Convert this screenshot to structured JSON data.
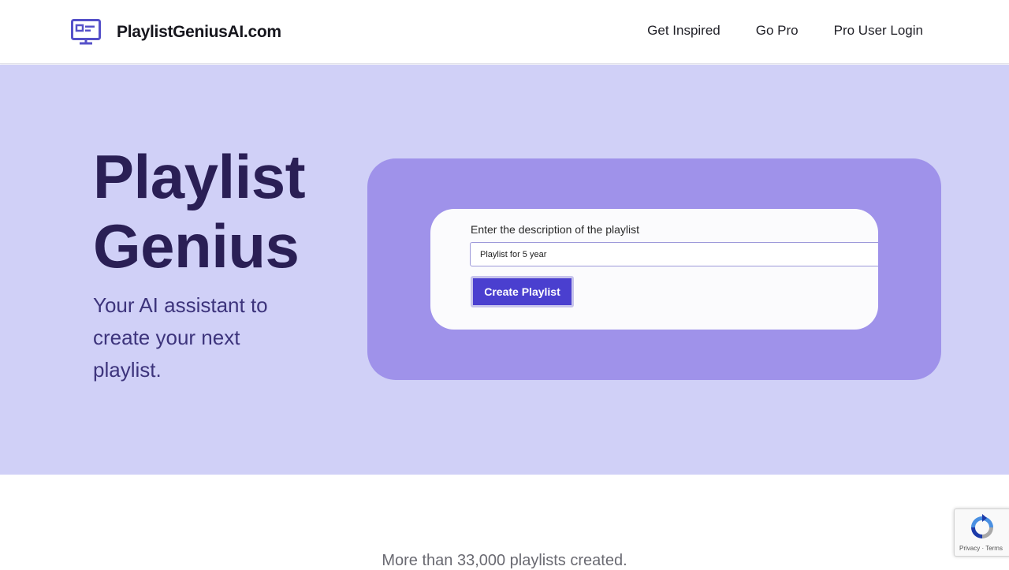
{
  "brand": {
    "name": "PlaylistGeniusAI.com",
    "logo_icon": "monitor-icon",
    "accent_color": "#5651c9"
  },
  "nav": {
    "links": [
      "Get Inspired",
      "Go Pro",
      "Pro User Login"
    ]
  },
  "hero": {
    "title_line1": "Playlist",
    "title_line2": "Genius",
    "subtitle": "Your AI assistant to create your next playlist.",
    "background_color": "#d0d0f7"
  },
  "demo": {
    "label": "Enter the description of the playlist",
    "input_value": "Playlist for 5 year",
    "button_label": "Create Playlist",
    "panel_color": "#9f92ea",
    "button_color": "#4a3fcf"
  },
  "stats": {
    "text": "More than 33,000 playlists created."
  },
  "recaptcha": {
    "icon": "recaptcha-icon",
    "links": "Privacy · Terms"
  }
}
